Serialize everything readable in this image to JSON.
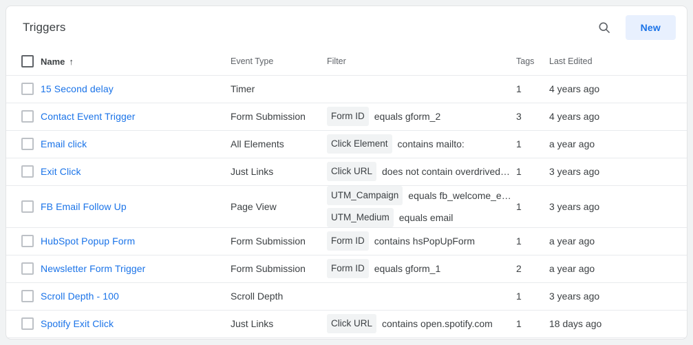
{
  "header": {
    "title": "Triggers",
    "search_icon": "search-icon",
    "new_button": "New",
    "accent_color": "#1a73e8",
    "new_button_bg": "#e8f0fe"
  },
  "table": {
    "columns": {
      "name": "Name",
      "sort_indicator": "↑",
      "event_type": "Event Type",
      "filter": "Filter",
      "tags": "Tags",
      "last_edited": "Last Edited"
    },
    "rows": [
      {
        "name": "15 Second delay",
        "event_type": "Timer",
        "filters": [],
        "tags": "1",
        "last_edited": "4 years ago"
      },
      {
        "name": "Contact Event Trigger",
        "event_type": "Form Submission",
        "filters": [
          {
            "variable": "Form ID",
            "condition": "equals gform_2"
          }
        ],
        "tags": "3",
        "last_edited": "4 years ago"
      },
      {
        "name": "Email click",
        "event_type": "All Elements",
        "filters": [
          {
            "variable": "Click Element",
            "condition": "contains mailto:"
          }
        ],
        "tags": "1",
        "last_edited": "a year ago"
      },
      {
        "name": "Exit Click",
        "event_type": "Just Links",
        "filters": [
          {
            "variable": "Click URL",
            "condition": "does not contain overdrivedi…"
          }
        ],
        "tags": "1",
        "last_edited": "3 years ago"
      },
      {
        "name": "FB Email Follow Up",
        "event_type": "Page View",
        "filters": [
          {
            "variable": "UTM_Campaign",
            "condition": "equals fb_welcome_e…"
          },
          {
            "variable": "UTM_Medium",
            "condition": "equals email"
          }
        ],
        "tags": "1",
        "last_edited": "3 years ago"
      },
      {
        "name": "HubSpot Popup Form",
        "event_type": "Form Submission",
        "filters": [
          {
            "variable": "Form ID",
            "condition": "contains hsPopUpForm"
          }
        ],
        "tags": "1",
        "last_edited": "a year ago"
      },
      {
        "name": "Newsletter Form Trigger",
        "event_type": "Form Submission",
        "filters": [
          {
            "variable": "Form ID",
            "condition": "equals gform_1"
          }
        ],
        "tags": "2",
        "last_edited": "a year ago"
      },
      {
        "name": "Scroll Depth - 100",
        "event_type": "Scroll Depth",
        "filters": [],
        "tags": "1",
        "last_edited": "3 years ago"
      },
      {
        "name": "Spotify Exit Click",
        "event_type": "Just Links",
        "filters": [
          {
            "variable": "Click URL",
            "condition": "contains open.spotify.com"
          }
        ],
        "tags": "1",
        "last_edited": "18 days ago"
      }
    ]
  }
}
